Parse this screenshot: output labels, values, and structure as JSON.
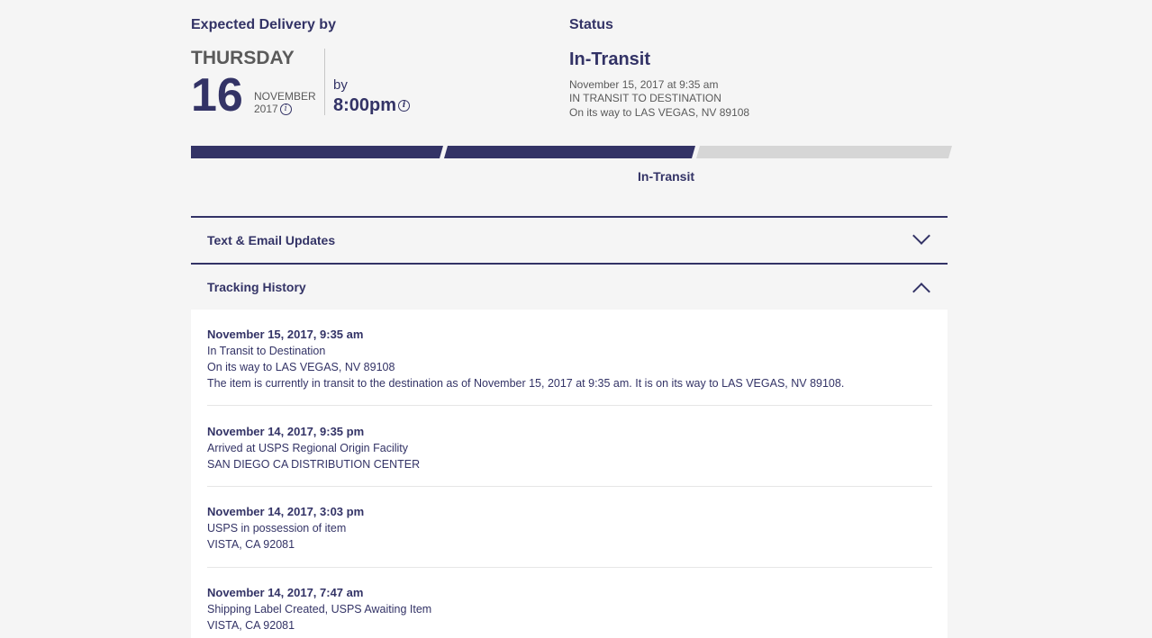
{
  "expected": {
    "title": "Expected Delivery by",
    "day": "THURSDAY",
    "date": "16",
    "month": "NOVEMBER",
    "year": "2017",
    "by_label": "by",
    "time": "8:00pm",
    "info_icon": "info-icon"
  },
  "status": {
    "title": "Status",
    "value": "In-Transit",
    "lines": [
      "November 15, 2017 at 9:35 am",
      "IN TRANSIT TO DESTINATION",
      "On its way to LAS VEGAS, NV 89108"
    ]
  },
  "progress": {
    "completed_steps": 2,
    "total_steps": 3,
    "label": "In-Transit",
    "active_color": "#333366",
    "inactive_color": "#d6d6d6"
  },
  "accordions": {
    "updates": {
      "label": "Text & Email Updates",
      "expanded": false,
      "icon": "chevron-down-icon"
    },
    "history": {
      "label": "Tracking History",
      "expanded": true,
      "icon": "chevron-up-icon"
    }
  },
  "history": [
    {
      "date": "November 15, 2017, 9:35 am",
      "lines": [
        "In Transit to Destination",
        "On its way to LAS VEGAS, NV 89108",
        "The item is currently in transit to the destination as of November 15, 2017 at 9:35 am. It is on its way to LAS VEGAS, NV 89108."
      ]
    },
    {
      "date": "November 14, 2017, 9:35 pm",
      "lines": [
        "Arrived at USPS Regional Origin Facility",
        "SAN DIEGO CA DISTRIBUTION CENTER"
      ]
    },
    {
      "date": "November 14, 2017, 3:03 pm",
      "lines": [
        "USPS in possession of item",
        "VISTA, CA 92081"
      ]
    },
    {
      "date": "November 14, 2017, 7:47 am",
      "lines": [
        "Shipping Label Created, USPS Awaiting Item",
        "VISTA, CA 92081"
      ]
    }
  ],
  "colors": {
    "brand": "#333366",
    "text_muted": "#5a5a5a",
    "background": "#f5f5f5"
  }
}
